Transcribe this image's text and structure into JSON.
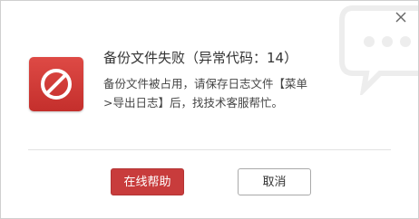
{
  "dialog": {
    "title": "备份文件失败（异常代码：14）",
    "message": "备份文件被占用，请保存日志文件【菜单>导出日志】后，找技术客服帮忙。"
  },
  "buttons": {
    "primary_label": "在线帮助",
    "secondary_label": "取消"
  },
  "icons": {
    "error": "prohibited-icon",
    "close": "close-icon",
    "watermark": "chat-bubble-icon"
  },
  "colors": {
    "accent": "#c83c3c",
    "icon_bg": "#d13e3a"
  }
}
